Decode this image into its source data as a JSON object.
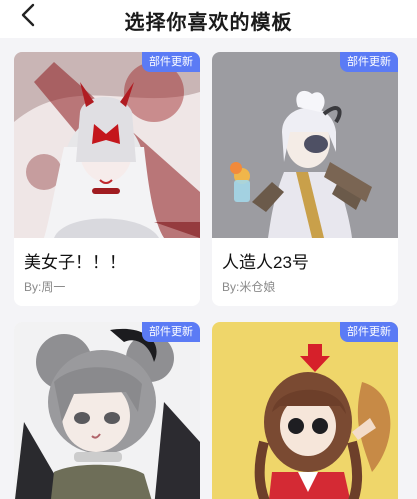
{
  "header": {
    "title": "选择你喜欢的模板"
  },
  "colors": {
    "accent": "#5b7bf5",
    "background": "#f4f4f7"
  },
  "icons": {
    "back": "chevron-left-icon"
  },
  "templates": [
    {
      "name": "美女子！！！",
      "author": "By:周一",
      "badge": "部件更新"
    },
    {
      "name": "人造人23号",
      "author": "By:米仓娘",
      "badge": "部件更新"
    },
    {
      "badge": "部件更新"
    },
    {
      "badge": "部件更新"
    }
  ]
}
